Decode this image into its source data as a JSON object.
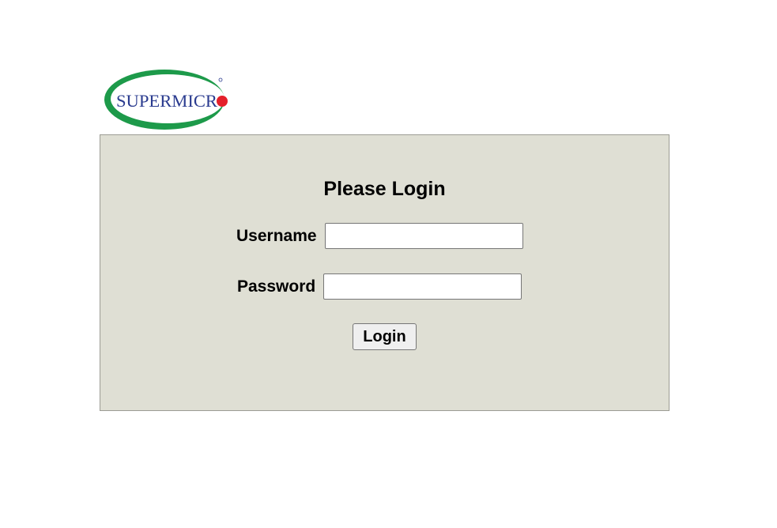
{
  "brand": {
    "logo_text": "SUPERMICR",
    "logo_icon": "supermicro-logo",
    "colors": {
      "green": "#1d9a4a",
      "navy": "#2a3b8f",
      "red": "#e4202a"
    }
  },
  "login": {
    "title": "Please Login",
    "username_label": "Username",
    "username_value": "",
    "password_label": "Password",
    "password_value": "",
    "submit_label": "Login"
  },
  "panel": {
    "background": "#dfdfd4"
  }
}
